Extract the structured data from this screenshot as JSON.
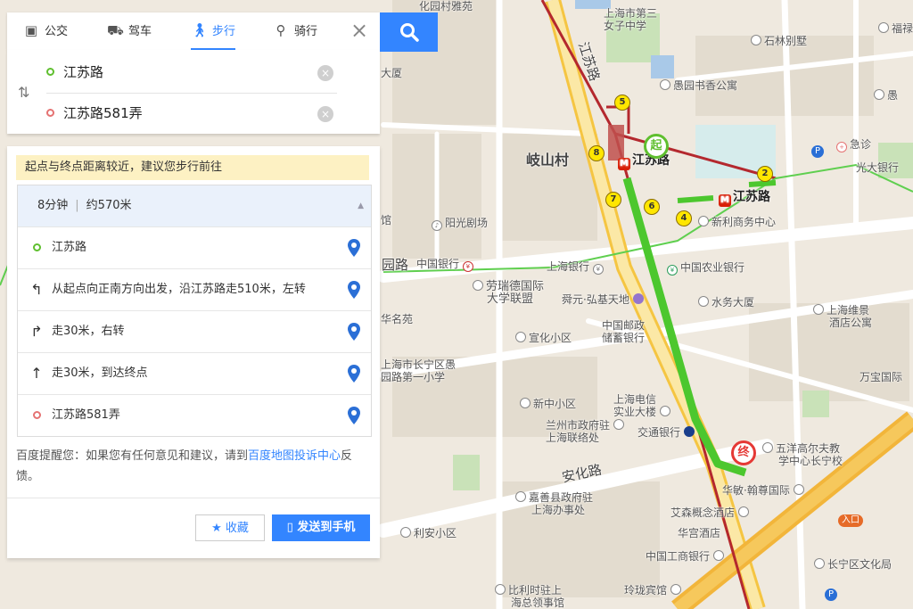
{
  "modes": [
    {
      "label": "公交",
      "icon": "bus-icon"
    },
    {
      "label": "驾车",
      "icon": "car-icon"
    },
    {
      "label": "步行",
      "icon": "walk-icon"
    },
    {
      "label": "骑行",
      "icon": "bike-icon"
    }
  ],
  "active_mode": "步行",
  "route": {
    "from": "江苏路",
    "to": "江苏路581弄"
  },
  "tip": "起点与终点距离较近，建议您步行前往",
  "summary": {
    "time": "8分钟",
    "distance": "约570米"
  },
  "steps": [
    {
      "text": "江苏路",
      "icon": "start-ring-icon"
    },
    {
      "text": "从起点向正南方向出发，沿江苏路走510米，左转",
      "icon": "turn-left-icon"
    },
    {
      "text": "走30米，右转",
      "icon": "turn-right-icon"
    },
    {
      "text": "走30米，到达终点",
      "icon": "straight-icon"
    },
    {
      "text": "江苏路581弄",
      "icon": "end-ring-icon"
    }
  ],
  "footnote": {
    "prefix": "百度提醒您：如果您有任何意见和建议，请到",
    "link": "百度地图投诉中心",
    "suffix": "反馈。"
  },
  "buttons": {
    "favorite": "收藏",
    "send": "发送到手机"
  },
  "map": {
    "markers": {
      "start": "起",
      "end": "终"
    },
    "exits": [
      "2",
      "4",
      "5",
      "6",
      "7",
      "8"
    ],
    "labels": {
      "qishancun": "岐山村",
      "jiangsulu_road": "江苏路",
      "anhualu": "安化路",
      "yuyuanlu": "园路",
      "metro_jiangsu_1": "江苏路",
      "metro_jiangsu_2": "江苏路",
      "zhongguo_yinhang": "中国银行",
      "shanghai_yinhang": "上海银行",
      "nongye_yinhang": "中国农业银行",
      "laorui": "劳瑞德国际",
      "laorui2": "大学联盟",
      "shunyuan": "舜元·弘基天地",
      "youzheng": "中国邮政",
      "youzheng2": "储蓄银行",
      "xuanhua": "宣化小区",
      "yangguang": "阳光剧场",
      "xinli": "新利商务中心",
      "shuiwu": "水务大厦",
      "dianxin": "上海电信",
      "dianxin2": "实业大楼",
      "xinzhong": "新中小区",
      "lanzhou": "兰州市政府驻",
      "lanzhou2": "上海联络处",
      "jiaotong": "交通银行",
      "jiashan": "嘉善县政府驻",
      "jiashan2": "上海办事处",
      "lian": "利安小区",
      "bilishi": "比利时驻上",
      "bilishi2": "海总领事馆",
      "linglong": "玲珑宾馆",
      "gongshang": "中国工商银行",
      "huagong": "华宫酒店",
      "aisen": "艾森概念酒店",
      "huamin": "华敏·翰尊国际",
      "wuyang": "五洋高尔夫教",
      "wuyang2": "学中心长宁校",
      "changning_wh": "长宁区文化局",
      "shanghai_wb": "上海维景",
      "shanghai_wb2": "酒店公寓",
      "wanbao": "万宝国际",
      "shilin": "石林别墅",
      "yuyuan_gy": "愚园书香公寓",
      "jizhen": "急诊",
      "guangda": "光大银行",
      "disan": "上海市第三",
      "disan2": "女子中学",
      "fuxing": "福禄",
      "yu": "愚",
      "yuhong": "上海市长宁区愚",
      "yuhong2": "园路第一小学",
      "huaming": "华名苑",
      "dasha": "大厦",
      "yajing": "化园村雅苑",
      "entrance": "入口",
      "gui": "馆",
      "hua": "华"
    }
  },
  "colors": {
    "accent": "#3385ff",
    "route_green": "#4cc72e",
    "metro_red": "#b4282e",
    "road_yellow": "#f5c542"
  }
}
